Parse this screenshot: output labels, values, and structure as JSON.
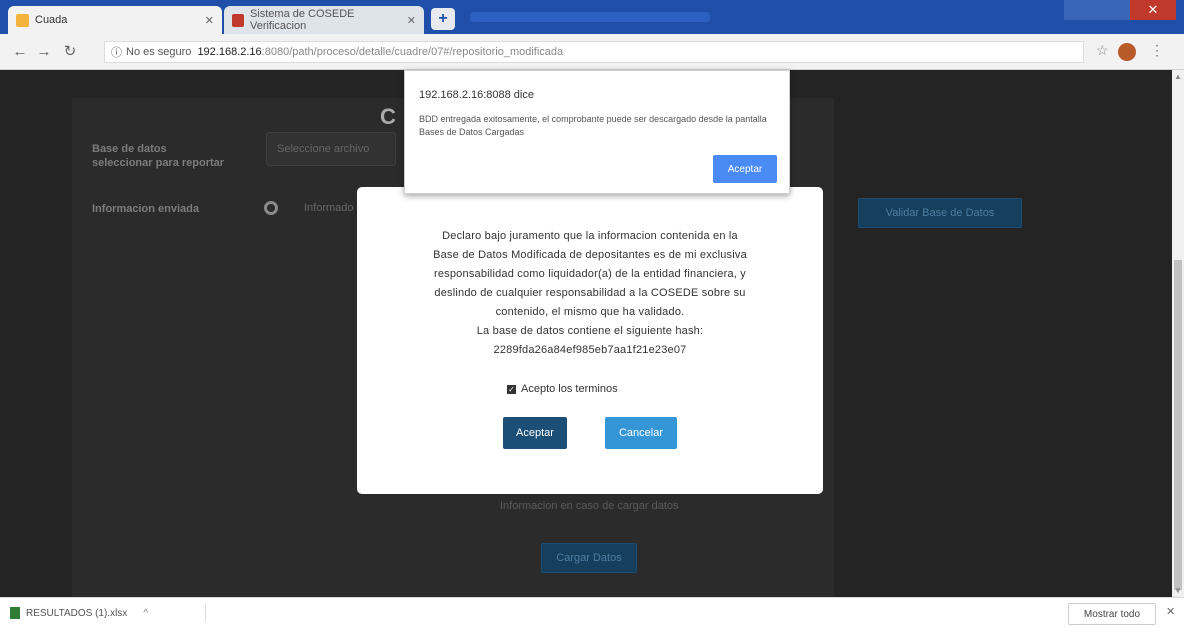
{
  "browser": {
    "tabs": [
      {
        "title": "Cuada"
      },
      {
        "title": "Sistema de COSEDE Verificacion"
      }
    ],
    "new_tab_symbol": "+",
    "address": {
      "security": "No es seguro",
      "host": "192.168.2.16",
      "path": ":8080/path/proceso/detalle/cuadre/07#/repositorio_modificada"
    },
    "window_close": "✕"
  },
  "page": {
    "heading_letter": "C",
    "field_labels": [
      "Base de datos",
      "seleccionar para reportar",
      "Informacion enviada"
    ],
    "select_value": "Seleccione archivo",
    "radio_label": "Informado",
    "right_button": "Validar Base de Datos",
    "bottom_note": "Informacion en caso de cargar datos",
    "bottom_button": "Cargar Datos"
  },
  "alert": {
    "title": "192.168.2.16:8088 dice",
    "message": "BDD entregada exitosamente, el comprobante puede ser descargado desde la pantalla Bases de Datos Cargadas",
    "ok_label": "Aceptar"
  },
  "modal": {
    "declaration_lines": [
      "Declaro bajo juramento que la informacion contenida en la",
      "Base de Datos Modificada de depositantes es de mi exclusiva",
      "responsabilidad como liquidador(a) de la entidad financiera, y",
      "deslindo de cualquier responsabilidad a la COSEDE sobre su",
      "contenido, el mismo que ha validado.",
      "La base de datos contiene el siguiente hash:",
      "2289fda26a84ef985eb7aa1f21e23e07"
    ],
    "checkbox_label": "Acepto los terminos",
    "checkbox_checked": true,
    "accept_label": "Aceptar",
    "cancel_label": "Cancelar"
  },
  "download_bar": {
    "file_name": "RESULTADOS (1).xlsx",
    "caret": "^",
    "show_all_label": "Mostrar todo",
    "close_symbol": "✕"
  }
}
